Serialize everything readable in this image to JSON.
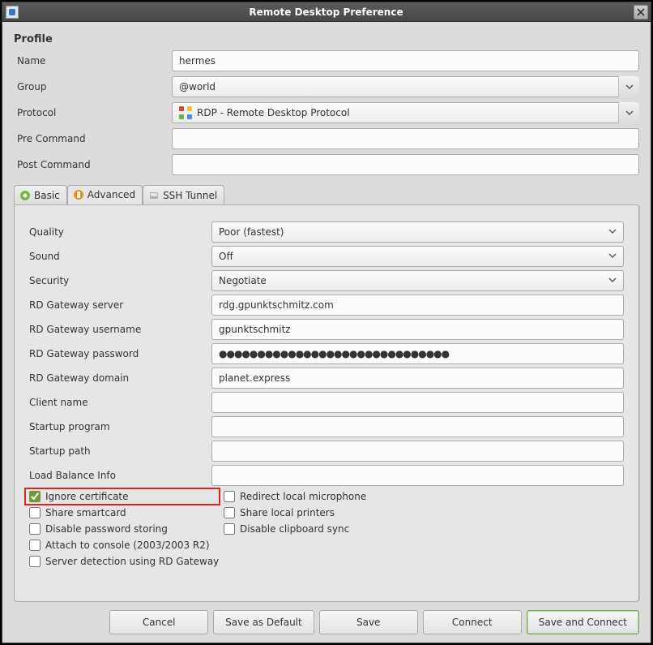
{
  "window": {
    "title": "Remote Desktop Preference"
  },
  "profile": {
    "section_title": "Profile",
    "labels": {
      "name": "Name",
      "group": "Group",
      "protocol": "Protocol",
      "pre_command": "Pre Command",
      "post_command": "Post Command"
    },
    "name_value": "hermes",
    "group_value": "@world",
    "protocol_value": "RDP - Remote Desktop Protocol",
    "pre_command_value": "",
    "post_command_value": ""
  },
  "tabs": {
    "basic": "Basic",
    "advanced": "Advanced",
    "ssh_tunnel": "SSH Tunnel",
    "active_index": 1
  },
  "advanced": {
    "labels": {
      "quality": "Quality",
      "sound": "Sound",
      "security": "Security",
      "rd_server": "RD Gateway server",
      "rd_user": "RD Gateway username",
      "rd_pass": "RD Gateway password",
      "rd_domain": "RD Gateway domain",
      "client_name": "Client name",
      "startup_program": "Startup program",
      "startup_path": "Startup path",
      "load_balance": "Load Balance Info"
    },
    "quality_value": "Poor (fastest)",
    "sound_value": "Off",
    "security_value": "Negotiate",
    "rd_server_value": "rdg.gpunktschmitz.com",
    "rd_user_value": "gpunktschmitz",
    "rd_pass_value": "●●●●●●●●●●●●●●●●●●●●●●●●●●●●●●",
    "rd_domain_value": "planet.express",
    "client_name_value": "",
    "startup_program_value": "",
    "startup_path_value": "",
    "load_balance_value": "",
    "checkboxes": {
      "ignore_cert": {
        "label": "Ignore certificate",
        "checked": true
      },
      "redirect_mic": {
        "label": "Redirect local microphone",
        "checked": false
      },
      "share_smartcard": {
        "label": "Share smartcard",
        "checked": false
      },
      "share_printers": {
        "label": "Share local printers",
        "checked": false
      },
      "disable_pwd_store": {
        "label": "Disable password storing",
        "checked": false
      },
      "disable_clipboard": {
        "label": "Disable clipboard sync",
        "checked": false
      },
      "attach_console": {
        "label": "Attach to console (2003/2003 R2)",
        "checked": false
      },
      "server_detect": {
        "label": "Server detection using RD Gateway",
        "checked": false
      }
    }
  },
  "buttons": {
    "cancel": "Cancel",
    "save_default": "Save as Default",
    "save": "Save",
    "connect": "Connect",
    "save_connect": "Save and Connect"
  }
}
